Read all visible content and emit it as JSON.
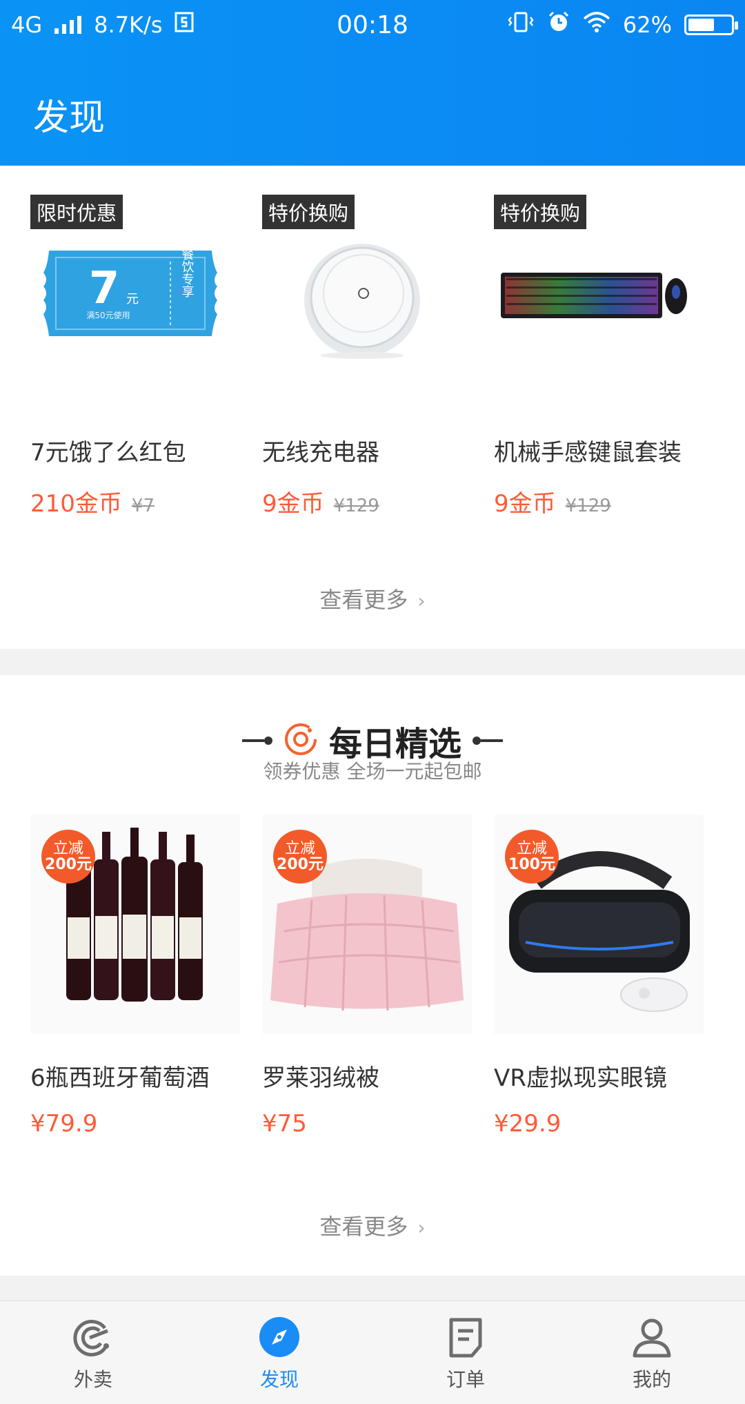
{
  "status_bar": {
    "network": "4G",
    "speed": "8.7K/s",
    "time": "00:18",
    "battery": "62%"
  },
  "header": {
    "title": "发现"
  },
  "exchange": {
    "items": [
      {
        "tag": "限时优惠",
        "name": "7元饿了么红包",
        "coins": "210金币",
        "original": "¥7",
        "coupon_value": "7",
        "coupon_unit": "元",
        "coupon_note": "满50元使用",
        "coupon_side": "餐饮专享"
      },
      {
        "tag": "特价换购",
        "name": "无线充电器",
        "coins": "9金币",
        "original": "¥129"
      },
      {
        "tag": "特价换购",
        "name": "机械手感键鼠套装",
        "coins": "9金币",
        "original": "¥129"
      }
    ],
    "more": "查看更多"
  },
  "daily": {
    "title": "每日精选",
    "subtitle": "领券优惠 全场一元起包邮",
    "items": [
      {
        "badge_top": "立减",
        "badge_bottom": "200元",
        "name": "6瓶西班牙葡萄酒",
        "price": "¥79.9"
      },
      {
        "badge_top": "立减",
        "badge_bottom": "200元",
        "name": "罗莱羽绒被",
        "price": "¥75"
      },
      {
        "badge_top": "立减",
        "badge_bottom": "100元",
        "name": "VR虚拟现实眼镜",
        "price": "¥29.9"
      }
    ],
    "more": "查看更多"
  },
  "tabbar": {
    "tabs": [
      {
        "label": "外卖"
      },
      {
        "label": "发现"
      },
      {
        "label": "订单"
      },
      {
        "label": "我的"
      }
    ]
  },
  "colors": {
    "header": "#0a8ff4",
    "price": "#ff5a37",
    "active_tab": "#1a8cf6",
    "badge": "#f25a2a"
  }
}
